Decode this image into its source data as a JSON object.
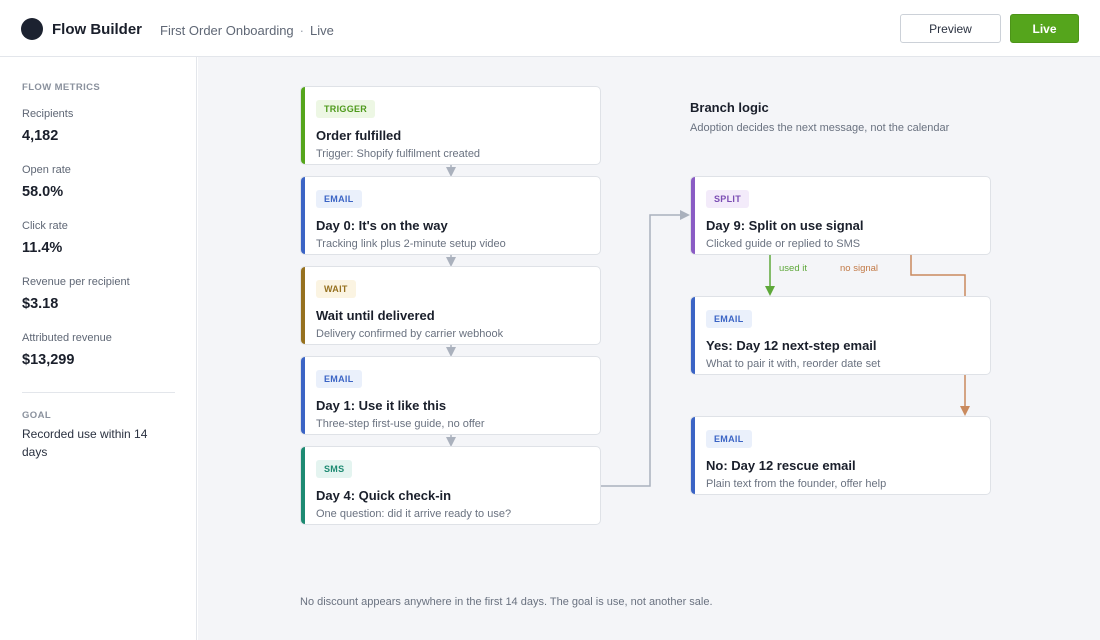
{
  "app": {
    "title": "Flow Builder",
    "flow_name": "First Order Onboarding",
    "separator": "·",
    "status": "Live"
  },
  "header": {
    "preview_label": "Preview",
    "live_label": "Live"
  },
  "sidebar": {
    "metrics_heading": "FLOW METRICS",
    "metrics": [
      {
        "label": "Recipients",
        "value": "4,182"
      },
      {
        "label": "Open rate",
        "value": "58.0%"
      },
      {
        "label": "Click rate",
        "value": "11.4%"
      },
      {
        "label": "Revenue per recipient",
        "value": "$3.18"
      },
      {
        "label": "Attributed revenue",
        "value": "$13,299"
      }
    ],
    "goal_heading": "GOAL",
    "goal_text": "Recorded use within 14 days"
  },
  "flow": {
    "nodes": [
      {
        "type": "TRIGGER",
        "title": "Order fulfilled",
        "subtitle": "Trigger: Shopify fulfilment created"
      },
      {
        "type": "EMAIL",
        "title": "Day 0: It's on the way",
        "subtitle": "Tracking link plus 2-minute setup video"
      },
      {
        "type": "WAIT",
        "title": "Wait until delivered",
        "subtitle": "Delivery confirmed by carrier webhook"
      },
      {
        "type": "EMAIL",
        "title": "Day 1: Use it like this",
        "subtitle": "Three-step first-use guide, no offer"
      },
      {
        "type": "SMS",
        "title": "Day 4: Quick check-in",
        "subtitle": "One question: did it arrive ready to use?"
      }
    ],
    "branch": {
      "title": "Branch logic",
      "subtitle": "Adoption decides the next message, not the calendar",
      "split": {
        "type": "SPLIT",
        "title": "Day 9: Split on use signal",
        "subtitle": "Clicked guide or replied to SMS"
      },
      "yes_label": "used it",
      "no_label": "no signal",
      "yes": {
        "type": "EMAIL",
        "title": "Yes: Day 12 next-step email",
        "subtitle": "What to pair it with, reorder date set"
      },
      "no": {
        "type": "EMAIL",
        "title": "No: Day 12 rescue email",
        "subtitle": "Plain text from the founder, offer help"
      }
    },
    "footnote": "No discount appears anywhere in the first 14 days. The goal is use, not another sale."
  },
  "colors": {
    "trigger": "#55a51c",
    "email": "#3b64c5",
    "wait": "#96711f",
    "sms": "#1d8a72",
    "split": "#8a5cc4",
    "yes_path": "#5ea83a",
    "no_path": "#c98a5e",
    "connector": "#aab1bd"
  }
}
